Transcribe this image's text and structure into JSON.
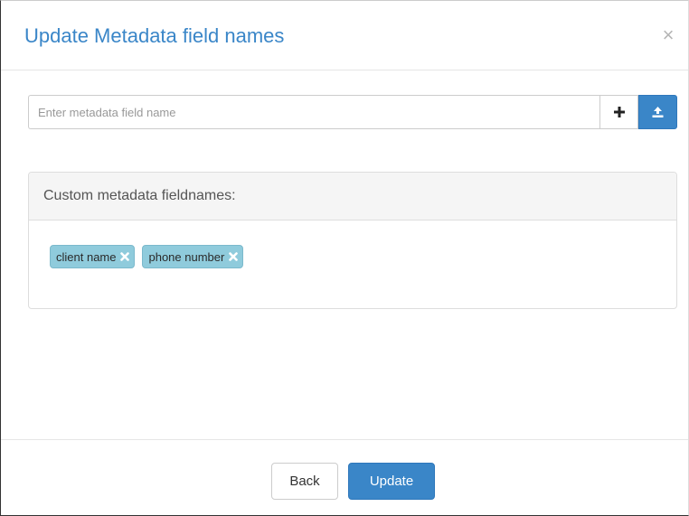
{
  "dialog": {
    "title": "Update Metadata field names",
    "close_label": "×"
  },
  "field_input": {
    "placeholder": "Enter metadata field name",
    "value": ""
  },
  "icons": {
    "add": "plus-icon",
    "upload": "upload-icon",
    "tag_remove": "x-icon"
  },
  "panel": {
    "heading": "Custom metadata fieldnames:",
    "tags": [
      {
        "label": "client name"
      },
      {
        "label": "phone number"
      }
    ]
  },
  "footer": {
    "back_label": "Back",
    "update_label": "Update"
  },
  "colors": {
    "accent": "#3a86c8",
    "tag_background": "#8fcbdc"
  }
}
